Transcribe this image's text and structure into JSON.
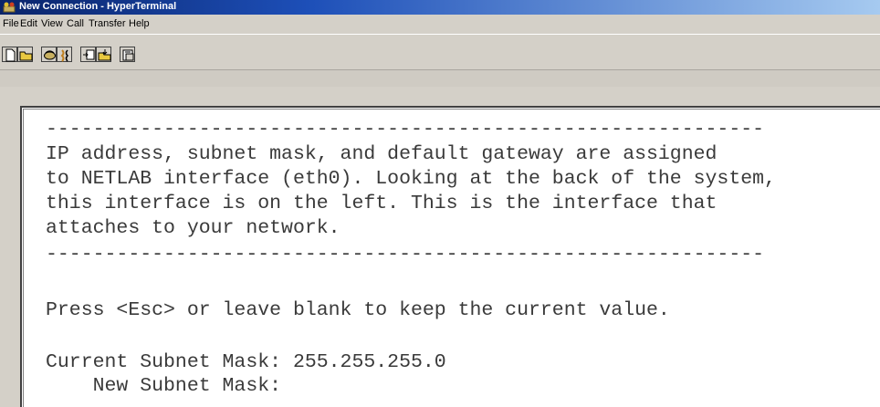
{
  "window": {
    "title": "New Connection - HyperTerminal",
    "icon": "hyperterminal-icon"
  },
  "menu": {
    "items": [
      "File",
      "Edit",
      "View",
      "Call",
      "Transfer",
      "Help"
    ]
  },
  "toolbar": {
    "buttons": [
      "new-icon",
      "open-icon",
      "connect-icon",
      "disconnect-icon",
      "send-icon",
      "receive-icon",
      "properties-icon"
    ]
  },
  "terminal": {
    "lines": [
      "-------------------------------------------------------------",
      "IP address, subnet mask, and default gateway are assigned",
      "to NETLAB interface (eth0). Looking at the back of the system,",
      "this interface is on the left. This is the interface that",
      "attaches to your network.",
      "-------------------------------------------------------------",
      "",
      "Press <Esc> or leave blank to keep the current value.",
      "",
      "Current Subnet Mask: 255.255.255.0",
      "    New Subnet Mask:"
    ]
  }
}
